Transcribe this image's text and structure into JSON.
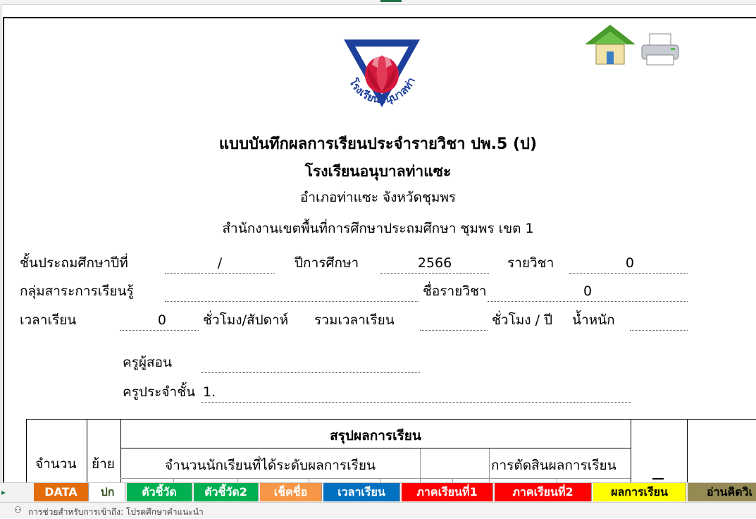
{
  "form": {
    "title": "แบบบันทึกผลการเรียนประจำรายวิชา ปพ.5 (ป)",
    "school": "โรงเรียนอนุบาลท่าแซะ",
    "district": "อำเภอท่าแซะ  จังหวัดชุมพร",
    "office": "สำนักงานเขตพื้นที่การศึกษาประถมศึกษา ชุมพร เขต 1",
    "logo_text": "โรงเรียนอนุบาลท่าแซะ"
  },
  "fields": {
    "grade_label": "ชั้นประถมศึกษาปีที่",
    "grade_value": "/",
    "year_label": "ปีการศึกษา",
    "year_value": "2566",
    "subject_code_label": "รายวิชา",
    "subject_code_value": "0",
    "group_label": "กลุ่มสาระการเรียนรู้",
    "subject_name_label": "ชื่อรายวิชา",
    "subject_name_value": "0",
    "hours_label": "เวลาเรียน",
    "hours_value": "0",
    "hours_unit": "ชั่วโมง/สัปดาห์",
    "total_label": "รวมเวลาเรียน",
    "year_unit": "ชั่วโมง / ปี",
    "weight_label": "น้ำหนัก",
    "teacher_label": "ครูผู้สอน",
    "homeroom_label": "ครูประจำชั้น",
    "homeroom_value": "1."
  },
  "table": {
    "summary_header": "สรุปผลการเรียน",
    "count_header": "จำนวน",
    "moved_header": "ย้าย",
    "levels_header": "จำนวนนักเรียนที่ได้ระดับผลการเรียน",
    "decision_header": "การตัดสินผลการเรียน"
  },
  "tabs": [
    {
      "label": "DATA",
      "bg": "#e36c0a",
      "fg": "#ffffff"
    },
    {
      "label": "ปก",
      "bg": "#ffffff",
      "fg": "#375623"
    },
    {
      "label": "ตัวชี้วัด",
      "bg": "#00b050",
      "fg": "#ffffff"
    },
    {
      "label": "ตัวชี้วัด2",
      "bg": "#00b050",
      "fg": "#ffffff"
    },
    {
      "label": "เช็คชื่อ",
      "bg": "#f79646",
      "fg": "#ffffff"
    },
    {
      "label": "เวลาเรียน",
      "bg": "#0070c0",
      "fg": "#ffffff"
    },
    {
      "label": "ภาคเรียนที่1",
      "bg": "#ff0000",
      "fg": "#ffffff"
    },
    {
      "label": "ภาคเรียนที่2",
      "bg": "#ff0000",
      "fg": "#ffffff"
    },
    {
      "label": "ผลการเรียน",
      "bg": "#ffff00",
      "fg": "#000000"
    },
    {
      "label": "อ่านคิดวิเ",
      "bg": "#948a54",
      "fg": "#000000"
    }
  ],
  "status": {
    "text": "การช่วยสำหรับการเข้าถึง: โปรดศึกษาคำแนะนำ"
  },
  "icons": {
    "home": "home-icon",
    "printer": "printer-icon"
  }
}
